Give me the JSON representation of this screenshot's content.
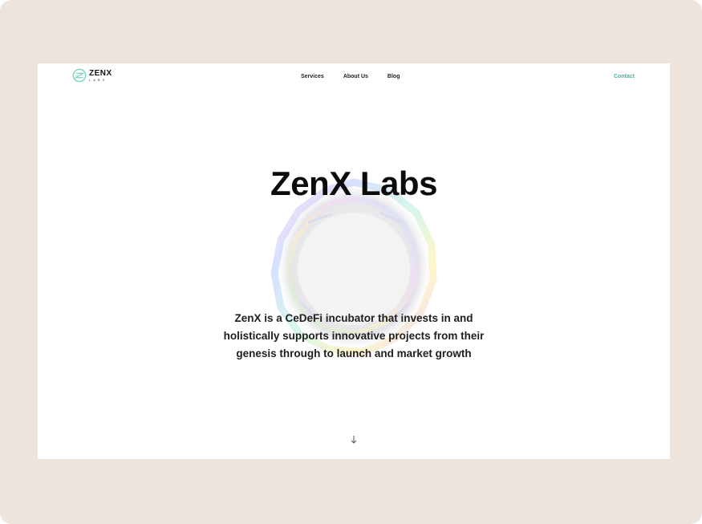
{
  "brand": {
    "name": "ZENX",
    "sub": "LABS"
  },
  "nav": {
    "links": [
      "Services",
      "About Us",
      "Blog"
    ],
    "contact": "Contact"
  },
  "hero": {
    "title": "ZenX Labs",
    "description": "ZenX is a CeDeFi incubator that invests in and holistically supports innovative projects from their genesis through to launch and market growth"
  },
  "icons": {
    "logo": "zenx-logo-icon",
    "scroll": "down-arrow-icon",
    "gem": "iridescent-crystal"
  },
  "colors": {
    "frame": "#ece4dd",
    "accent": "#3bbfa6",
    "text": "#0c0c0c"
  }
}
